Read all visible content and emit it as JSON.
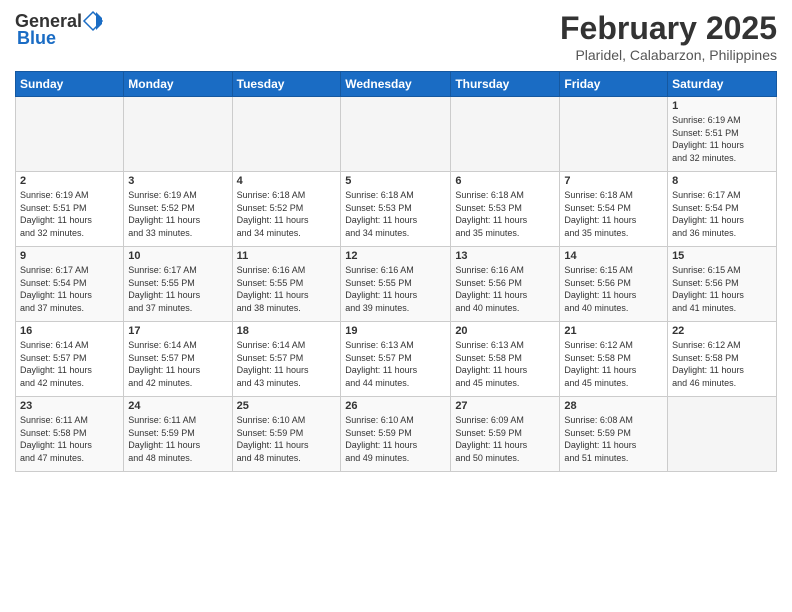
{
  "header": {
    "logo_general": "General",
    "logo_blue": "Blue",
    "title": "February 2025",
    "subtitle": "Plaridel, Calabarzon, Philippines"
  },
  "calendar": {
    "days_of_week": [
      "Sunday",
      "Monday",
      "Tuesday",
      "Wednesday",
      "Thursday",
      "Friday",
      "Saturday"
    ],
    "weeks": [
      [
        {
          "day": "",
          "info": ""
        },
        {
          "day": "",
          "info": ""
        },
        {
          "day": "",
          "info": ""
        },
        {
          "day": "",
          "info": ""
        },
        {
          "day": "",
          "info": ""
        },
        {
          "day": "",
          "info": ""
        },
        {
          "day": "1",
          "info": "Sunrise: 6:19 AM\nSunset: 5:51 PM\nDaylight: 11 hours\nand 32 minutes."
        }
      ],
      [
        {
          "day": "2",
          "info": "Sunrise: 6:19 AM\nSunset: 5:51 PM\nDaylight: 11 hours\nand 32 minutes."
        },
        {
          "day": "3",
          "info": "Sunrise: 6:19 AM\nSunset: 5:52 PM\nDaylight: 11 hours\nand 33 minutes."
        },
        {
          "day": "4",
          "info": "Sunrise: 6:18 AM\nSunset: 5:52 PM\nDaylight: 11 hours\nand 34 minutes."
        },
        {
          "day": "5",
          "info": "Sunrise: 6:18 AM\nSunset: 5:53 PM\nDaylight: 11 hours\nand 34 minutes."
        },
        {
          "day": "6",
          "info": "Sunrise: 6:18 AM\nSunset: 5:53 PM\nDaylight: 11 hours\nand 35 minutes."
        },
        {
          "day": "7",
          "info": "Sunrise: 6:18 AM\nSunset: 5:54 PM\nDaylight: 11 hours\nand 35 minutes."
        },
        {
          "day": "8",
          "info": "Sunrise: 6:17 AM\nSunset: 5:54 PM\nDaylight: 11 hours\nand 36 minutes."
        }
      ],
      [
        {
          "day": "9",
          "info": "Sunrise: 6:17 AM\nSunset: 5:54 PM\nDaylight: 11 hours\nand 37 minutes."
        },
        {
          "day": "10",
          "info": "Sunrise: 6:17 AM\nSunset: 5:55 PM\nDaylight: 11 hours\nand 37 minutes."
        },
        {
          "day": "11",
          "info": "Sunrise: 6:16 AM\nSunset: 5:55 PM\nDaylight: 11 hours\nand 38 minutes."
        },
        {
          "day": "12",
          "info": "Sunrise: 6:16 AM\nSunset: 5:55 PM\nDaylight: 11 hours\nand 39 minutes."
        },
        {
          "day": "13",
          "info": "Sunrise: 6:16 AM\nSunset: 5:56 PM\nDaylight: 11 hours\nand 40 minutes."
        },
        {
          "day": "14",
          "info": "Sunrise: 6:15 AM\nSunset: 5:56 PM\nDaylight: 11 hours\nand 40 minutes."
        },
        {
          "day": "15",
          "info": "Sunrise: 6:15 AM\nSunset: 5:56 PM\nDaylight: 11 hours\nand 41 minutes."
        }
      ],
      [
        {
          "day": "16",
          "info": "Sunrise: 6:14 AM\nSunset: 5:57 PM\nDaylight: 11 hours\nand 42 minutes."
        },
        {
          "day": "17",
          "info": "Sunrise: 6:14 AM\nSunset: 5:57 PM\nDaylight: 11 hours\nand 42 minutes."
        },
        {
          "day": "18",
          "info": "Sunrise: 6:14 AM\nSunset: 5:57 PM\nDaylight: 11 hours\nand 43 minutes."
        },
        {
          "day": "19",
          "info": "Sunrise: 6:13 AM\nSunset: 5:57 PM\nDaylight: 11 hours\nand 44 minutes."
        },
        {
          "day": "20",
          "info": "Sunrise: 6:13 AM\nSunset: 5:58 PM\nDaylight: 11 hours\nand 45 minutes."
        },
        {
          "day": "21",
          "info": "Sunrise: 6:12 AM\nSunset: 5:58 PM\nDaylight: 11 hours\nand 45 minutes."
        },
        {
          "day": "22",
          "info": "Sunrise: 6:12 AM\nSunset: 5:58 PM\nDaylight: 11 hours\nand 46 minutes."
        }
      ],
      [
        {
          "day": "23",
          "info": "Sunrise: 6:11 AM\nSunset: 5:58 PM\nDaylight: 11 hours\nand 47 minutes."
        },
        {
          "day": "24",
          "info": "Sunrise: 6:11 AM\nSunset: 5:59 PM\nDaylight: 11 hours\nand 48 minutes."
        },
        {
          "day": "25",
          "info": "Sunrise: 6:10 AM\nSunset: 5:59 PM\nDaylight: 11 hours\nand 48 minutes."
        },
        {
          "day": "26",
          "info": "Sunrise: 6:10 AM\nSunset: 5:59 PM\nDaylight: 11 hours\nand 49 minutes."
        },
        {
          "day": "27",
          "info": "Sunrise: 6:09 AM\nSunset: 5:59 PM\nDaylight: 11 hours\nand 50 minutes."
        },
        {
          "day": "28",
          "info": "Sunrise: 6:08 AM\nSunset: 5:59 PM\nDaylight: 11 hours\nand 51 minutes."
        },
        {
          "day": "",
          "info": ""
        }
      ]
    ]
  }
}
